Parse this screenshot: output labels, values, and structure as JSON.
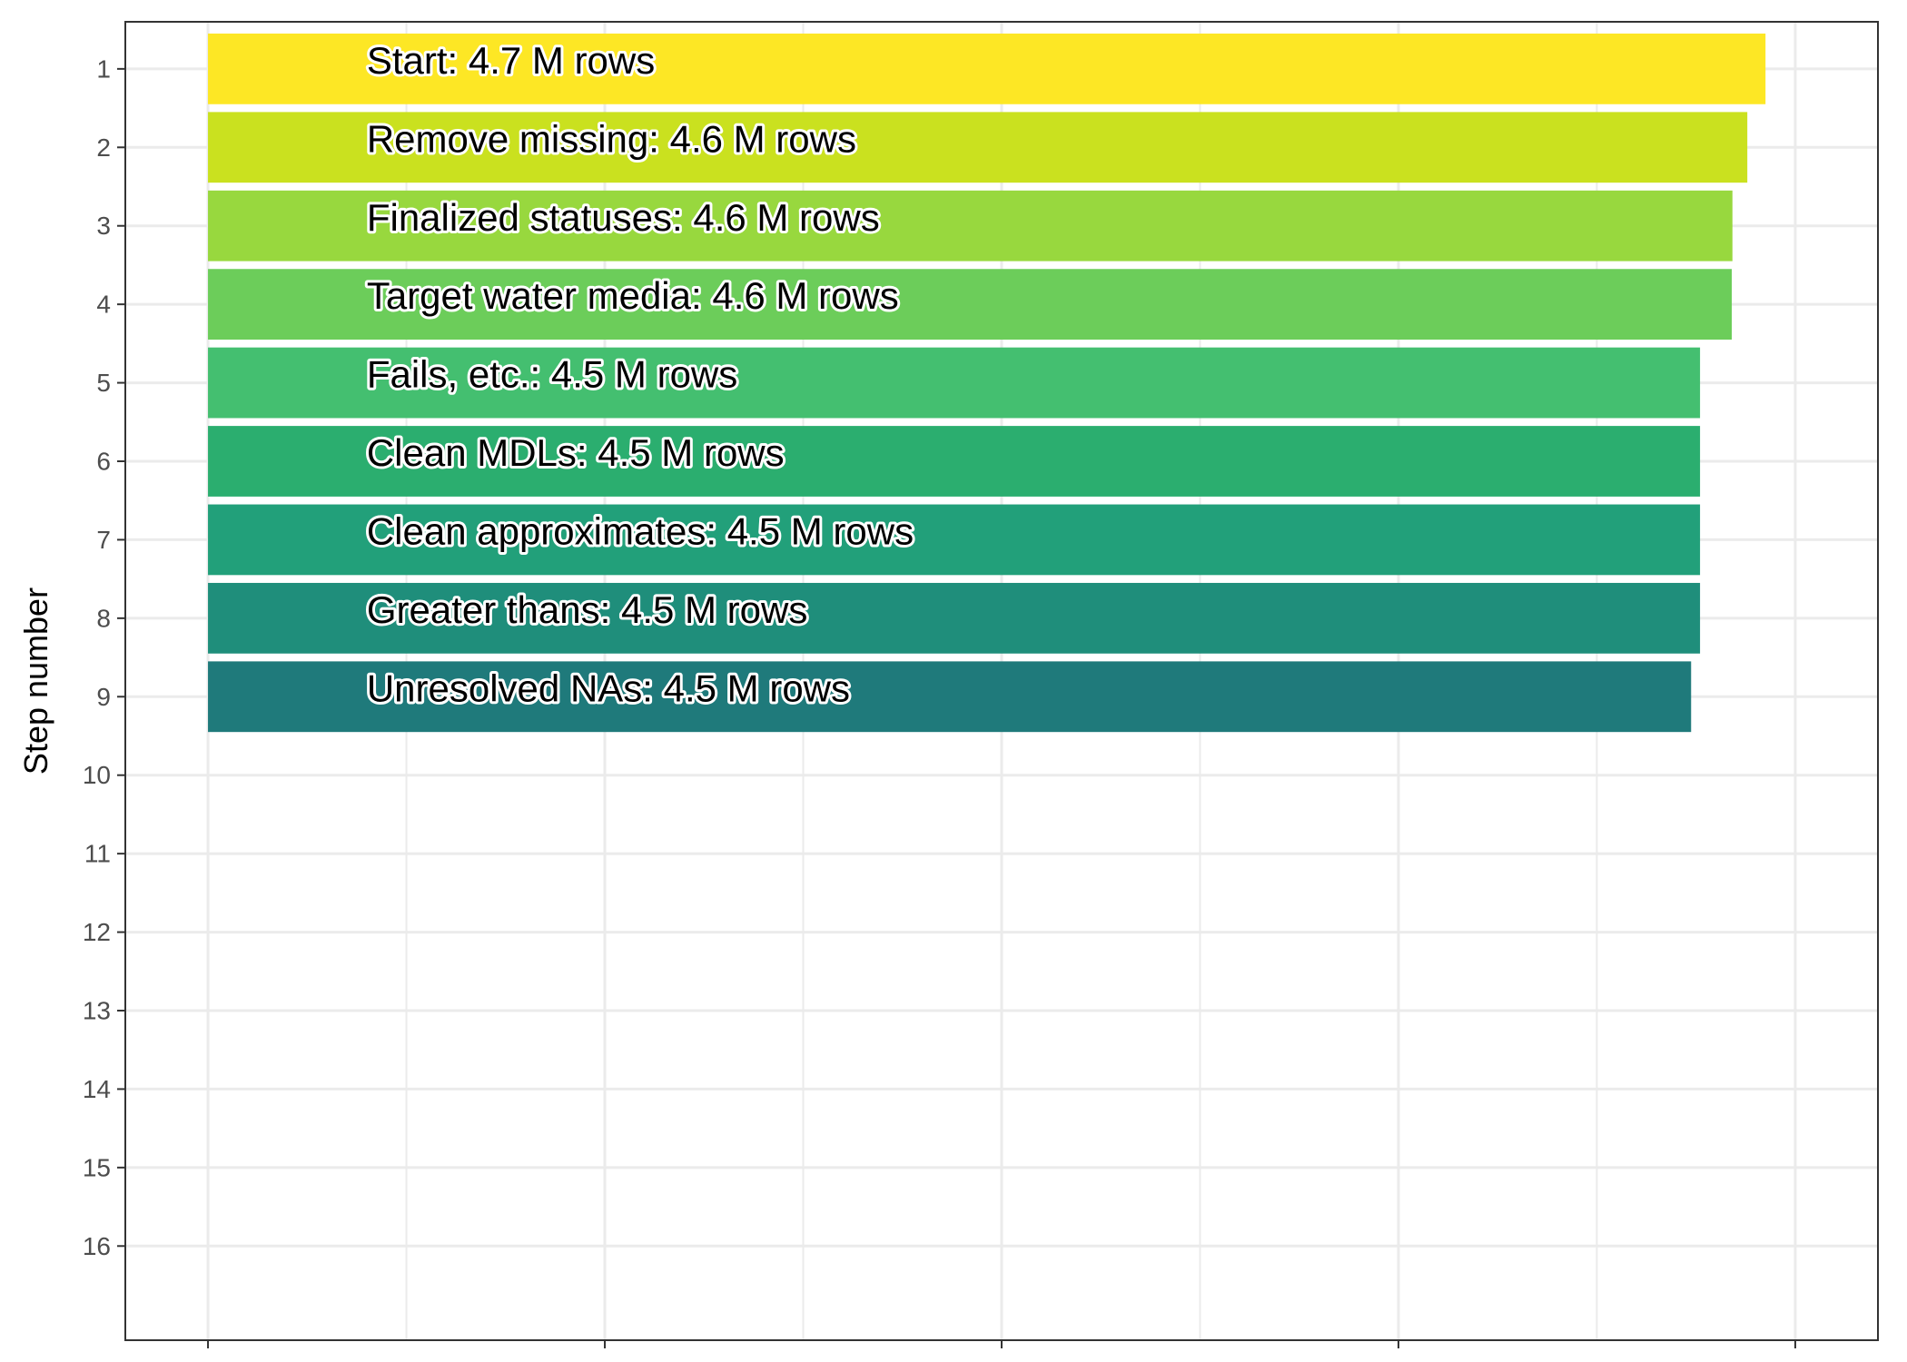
{
  "chart_data": {
    "type": "bar",
    "orientation": "horizontal",
    "title": "",
    "xlabel": "",
    "ylabel": "Step number",
    "y_categories": [
      "1",
      "2",
      "3",
      "4",
      "5",
      "6",
      "7",
      "8",
      "9",
      "10",
      "11",
      "12",
      "13",
      "14",
      "15",
      "16"
    ],
    "x_axis": {
      "ticks": [
        0,
        1200000,
        2400000,
        3600000,
        4800000
      ],
      "tick_labels_visible": false
    },
    "xlim": [
      -250000,
      5050000
    ],
    "grid": true,
    "legend": "none",
    "bars": [
      {
        "step": 1,
        "label": "Start:  4.7 M rows",
        "value": 4710000,
        "color": "#FDE725"
      },
      {
        "step": 2,
        "label": "Remove missing:  4.6 M rows",
        "value": 4655000,
        "color": "#CAE11F"
      },
      {
        "step": 3,
        "label": "Finalized statuses:  4.6 M rows",
        "value": 4610000,
        "color": "#98D83E"
      },
      {
        "step": 4,
        "label": "Target water media:  4.6 M rows",
        "value": 4608000,
        "color": "#6CCD5A"
      },
      {
        "step": 5,
        "label": "Fails, etc.:  4.5 M rows",
        "value": 4512000,
        "color": "#44BF70"
      },
      {
        "step": 6,
        "label": "Clean MDLs:  4.5 M rows",
        "value": 4512000,
        "color": "#2BAE6F"
      },
      {
        "step": 7,
        "label": "Clean approximates:  4.5 M rows",
        "value": 4512000,
        "color": "#22A07A"
      },
      {
        "step": 8,
        "label": "Greater thans:  4.5 M rows",
        "value": 4512000,
        "color": "#1F8E7B"
      },
      {
        "step": 9,
        "label": "Unresolved NAs:  4.5 M rows",
        "value": 4485000,
        "color": "#1F7A7B"
      }
    ]
  }
}
